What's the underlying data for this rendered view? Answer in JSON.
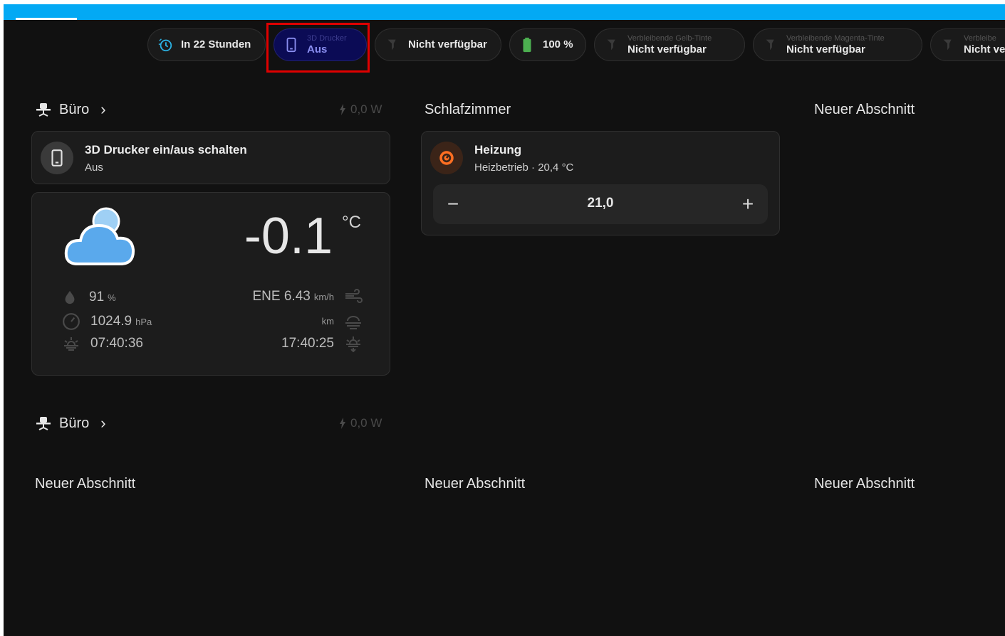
{
  "badges": [
    {
      "id": "timer",
      "name": "",
      "state": "In 22 Stunden",
      "icon": "clock-timer-icon"
    },
    {
      "id": "printer",
      "name": "3D Drucker",
      "state": "Aus",
      "icon": "tablet-phone-icon",
      "active": true
    },
    {
      "id": "toner",
      "name": "",
      "state": "Nicht verfügbar",
      "icon": "ink-drop-icon"
    },
    {
      "id": "battery",
      "name": "",
      "state": "100 %",
      "icon": "battery-full-icon"
    },
    {
      "id": "ink-yellow",
      "name": "Verbleibende Gelb-Tinte",
      "state": "Nicht verfügbar",
      "icon": "ink-drop-icon"
    },
    {
      "id": "ink-magenta",
      "name": "Verbleibende Magenta-Tinte",
      "state": "Nicht verfügbar",
      "icon": "ink-drop-icon"
    },
    {
      "id": "ink-more",
      "name": "Verbleibe",
      "state": "Nicht ve",
      "icon": "ink-drop-icon"
    }
  ],
  "buero1": {
    "title": "Büro",
    "chevron": "›",
    "power": "0,0 W"
  },
  "tile_printer": {
    "name": "3D Drucker ein/aus schalten",
    "state": "Aus"
  },
  "weather": {
    "temp": "-0.1",
    "temp_unit": "°C",
    "condition_icon": "partly-cloudy-icon",
    "humidity": "91",
    "humidity_unit": "%",
    "pressure": "1024.9",
    "pressure_unit": "hPa",
    "sunrise": "07:40:36",
    "wind": "ENE 6.43",
    "wind_unit": "km/h",
    "visibility_unit": "km",
    "sunset": "17:40:25"
  },
  "schlafzimmer": {
    "title": "Schlafzimmer"
  },
  "heizung": {
    "name": "Heizung",
    "state": "Heizbetrieb · 20,4 °C",
    "target": "21,0",
    "minus": "−",
    "plus": "+"
  },
  "neuer1": {
    "title": "Neuer Abschnitt"
  },
  "buero2": {
    "title": "Büro",
    "chevron": "›",
    "power": "0,0 W"
  },
  "neuer2": {
    "title": "Neuer Abschnitt"
  },
  "neuer3": {
    "title": "Neuer Abschnitt"
  },
  "neuer4": {
    "title": "Neuer Abschnitt"
  },
  "colors": {
    "accent": "#03a9f4",
    "heating": "#ff6f22",
    "battery": "#4caf50",
    "active_badge": "#0b0b55",
    "highlight": "#e00000"
  }
}
